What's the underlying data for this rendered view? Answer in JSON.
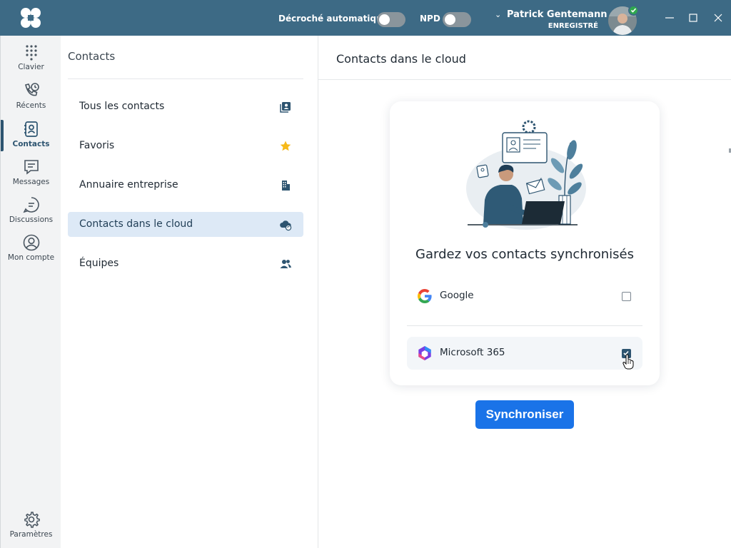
{
  "titlebar": {
    "auto_answer_label": "Décroché automatique",
    "dnd_label": "NPD",
    "user_name": "Patrick Gentemann",
    "user_status": "ENREGISTRÉ"
  },
  "nav": {
    "items": [
      {
        "label": "Clavier",
        "icon": "dialpad-icon"
      },
      {
        "label": "Récents",
        "icon": "recent-calls-icon"
      },
      {
        "label": "Contacts",
        "icon": "contacts-book-icon",
        "active": true
      },
      {
        "label": "Messages",
        "icon": "message-icon"
      },
      {
        "label": "Discussions",
        "icon": "chat-icon"
      },
      {
        "label": "Mon compte",
        "icon": "account-icon"
      }
    ],
    "settings_label": "Paramètres"
  },
  "contacts_panel": {
    "title": "Contacts",
    "items": [
      {
        "label": "Tous les contacts",
        "icon": "contact-list-icon"
      },
      {
        "label": "Favoris",
        "icon": "star-icon"
      },
      {
        "label": "Annuaire entreprise",
        "icon": "building-icon"
      },
      {
        "label": "Contacts dans le cloud",
        "icon": "cloud-sync-icon",
        "selected": true
      },
      {
        "label": "Équipes",
        "icon": "team-icon"
      }
    ]
  },
  "cloud": {
    "title": "Contacts dans le cloud",
    "heading": "Gardez vos contacts synchronisés",
    "providers": [
      {
        "name": "Google",
        "checked": false
      },
      {
        "name": "Microsoft 365",
        "checked": true
      }
    ],
    "sync_button": "Synchroniser"
  },
  "colors": {
    "titlebar": "#3d6a85",
    "accent": "#2d5470",
    "selected_bg": "#dde9f6",
    "sync_button": "#1a73e8",
    "favorite_star": "#f6b91a"
  }
}
